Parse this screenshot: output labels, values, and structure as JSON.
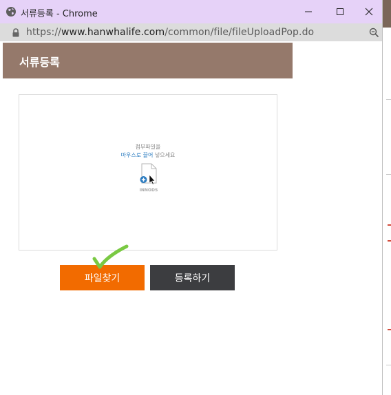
{
  "window": {
    "title": "서류등록 - Chrome",
    "minimize_symbol": "—",
    "maximize_symbol": "☐",
    "close_symbol": "✕"
  },
  "address": {
    "scheme": "https://",
    "host": "www.hanwhalife.com",
    "path": "/common/file/fileUploadPop.do"
  },
  "page": {
    "header_title": "서류등록",
    "dropzone": {
      "line1": "첨부파일을",
      "line2_highlight": "마우스로 끌어",
      "line2_rest": " 넣으세요",
      "logo_text": "INNODS"
    },
    "buttons": {
      "find_label": "파일찾기",
      "register_label": "등록하기"
    }
  },
  "colors": {
    "titlebar": "#e6d2f8",
    "header": "#95796b",
    "find_button": "#f26b00",
    "register_button": "#3c3d40",
    "checkmark": "#7ac943"
  }
}
